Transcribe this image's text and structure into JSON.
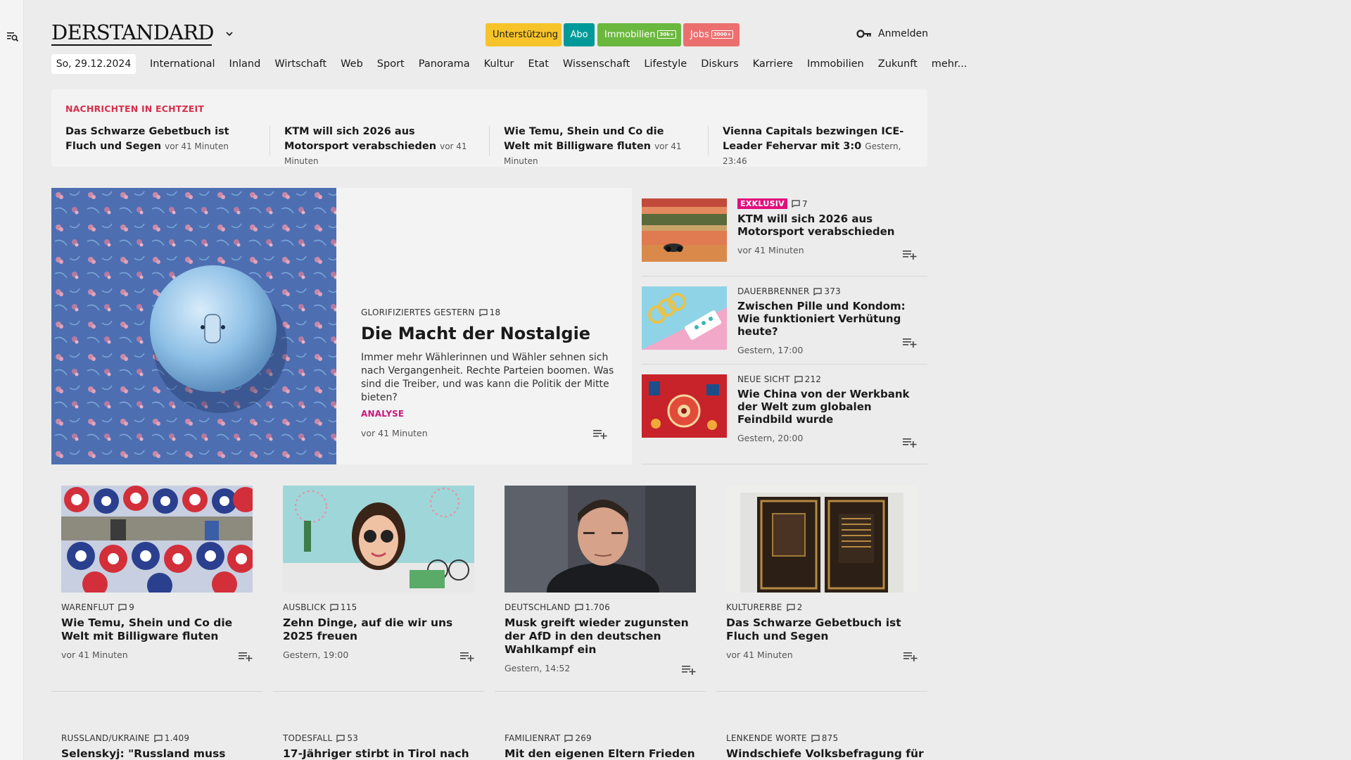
{
  "header": {
    "logo": "DERSTANDARD",
    "pills": {
      "support": "Unterstützung",
      "abo": "Abo",
      "immo": "Immobilien",
      "immo_tag": "30k+",
      "jobs": "Jobs",
      "jobs_tag": "3000+"
    },
    "login": "Anmelden"
  },
  "nav": {
    "date": "So, 29.12.2024",
    "items": [
      "International",
      "Inland",
      "Wirtschaft",
      "Web",
      "Sport",
      "Panorama",
      "Kultur",
      "Etat",
      "Wissenschaft",
      "Lifestyle",
      "Diskurs",
      "Karriere",
      "Immobilien",
      "Zukunft",
      "mehr..."
    ]
  },
  "ticker": {
    "title": "NACHRICHTEN IN ECHTZEIT",
    "items": [
      {
        "title": "Das Schwarze Gebetbuch ist Fluch und Segen",
        "time": "vor 41 Minuten"
      },
      {
        "title": "KTM will sich 2026 aus Motorsport verabschieden",
        "time": "vor 41 Minuten"
      },
      {
        "title": "Wie Temu, Shein und Co die Welt mit Billigware fluten",
        "time": "vor 41 Minuten"
      },
      {
        "title": "Vienna Capitals bezwingen ICE-Leader Fehervar mit 3:0",
        "time": "Gestern, 23:46"
      }
    ]
  },
  "hero": {
    "kicker": "GLORIFIZIERTES GESTERN",
    "comments": "18",
    "title": "Die Macht der Nostalgie",
    "text": "Immer mehr Wählerinnen und Wähler sehnen sich nach Vergangenheit. Rechte Parteien boomen. Was sind die Treiber, und was kann die Politik der Mitte bieten?",
    "tag": "ANALYSE",
    "time": "vor 41 Minuten"
  },
  "side": [
    {
      "badge": "EXKLUSIV",
      "kicker": "",
      "comments": "7",
      "title": "KTM will sich 2026 aus Motorsport verabschieden",
      "time": "vor 41 Minuten"
    },
    {
      "badge": "",
      "kicker": "DAUERBRENNER",
      "comments": "373",
      "title": "Zwischen Pille und Kondom: Wie funktioniert Verhütung heute?",
      "time": "Gestern, 17:00"
    },
    {
      "badge": "",
      "kicker": "NEUE SICHT",
      "comments": "212",
      "title": "Wie China von der Werkbank der Welt zum globalen Feindbild wurde",
      "time": "Gestern, 20:00"
    }
  ],
  "cards": [
    {
      "kicker": "WARENFLUT",
      "comments": "9",
      "title": "Wie Temu, Shein und Co die Welt mit Billigware fluten",
      "time": "vor 41 Minuten"
    },
    {
      "kicker": "AUSBLICK",
      "comments": "115",
      "title": "Zehn Dinge, auf die wir uns 2025 freuen",
      "time": "Gestern, 19:00"
    },
    {
      "kicker": "DEUTSCHLAND",
      "comments": "1.706",
      "title": "Musk greift wieder zugunsten der AfD in den deutschen Wahlkampf ein",
      "time": "Gestern, 14:52"
    },
    {
      "kicker": "KULTURERBE",
      "comments": "2",
      "title": "Das Schwarze Gebetbuch ist Fluch und Segen",
      "time": "vor 41 Minuten"
    }
  ],
  "cards2": [
    {
      "kicker": "RUSSLAND/UKRAINE",
      "comments": "1.409",
      "title": "Selenskyj: \"Russland muss"
    },
    {
      "kicker": "TODESFALL",
      "comments": "53",
      "title": "17-Jähriger stirbt in Tirol nach"
    },
    {
      "kicker": "FAMILIENRAT",
      "comments": "269",
      "title": "Mit den eigenen Eltern Frieden"
    },
    {
      "kicker": "LENKENDE WORTE",
      "comments": "875",
      "title": "Windschiefe Volksbefragung für ein"
    }
  ],
  "icons": {
    "menu": "menu-search-icon",
    "caret": "chevron-down-icon",
    "key": "key-icon",
    "comment": "comment-icon",
    "add": "add-to-playlist-icon"
  },
  "colors": {
    "background": "#ececec",
    "panel": "#f3f3f3",
    "support": "#f6c42a",
    "abo": "#009999",
    "immo": "#6bb83e",
    "jobs": "#ec6f6f",
    "ticker_title": "#d5304c",
    "accent_pink": "#c8197a",
    "badge": "#e0107d"
  }
}
